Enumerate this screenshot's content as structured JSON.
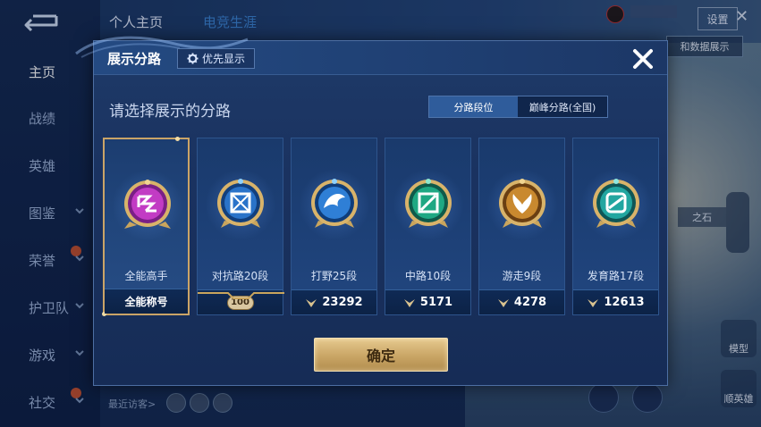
{
  "background": {
    "tabs": [
      "个人主页",
      "电竞生涯"
    ],
    "sidebar": [
      {
        "label": "主页",
        "active": true,
        "chevron": false,
        "badge": false
      },
      {
        "label": "战绩",
        "active": false,
        "chevron": false,
        "badge": false
      },
      {
        "label": "英雄",
        "active": false,
        "chevron": false,
        "badge": false
      },
      {
        "label": "图鉴",
        "active": false,
        "chevron": true,
        "badge": false
      },
      {
        "label": "荣誉",
        "active": false,
        "chevron": true,
        "badge": true
      },
      {
        "label": "护卫队",
        "active": false,
        "chevron": true,
        "badge": false
      },
      {
        "label": "游戏",
        "active": false,
        "chevron": true,
        "badge": false
      },
      {
        "label": "社交",
        "active": false,
        "chevron": true,
        "badge": true
      }
    ],
    "top_right_button": "设置",
    "data_display_chip": "和数据展示",
    "right_chip": "之石",
    "visitors_label": "最近访客>",
    "side_buttons": [
      "模型",
      "顺英雄"
    ]
  },
  "modal": {
    "title": "展示分路",
    "priority_button": "优先显示",
    "subtitle": "请选择展示的分路",
    "toggle": [
      {
        "label": "分路段位",
        "active": true
      },
      {
        "label": "巅峰分路(全国)",
        "active": false
      }
    ],
    "cards": [
      {
        "label": "全能高手",
        "bottom": "全能称号",
        "selected": true,
        "icon": "allround-emblem-icon",
        "color": "#c23bc4"
      },
      {
        "label": "对抗路20段",
        "bottom": "100",
        "selected": false,
        "icon": "clash-lane-emblem-icon",
        "color": "#2a73c9"
      },
      {
        "label": "打野25段",
        "bottom": "23292",
        "selected": false,
        "icon": "jungle-emblem-icon",
        "color": "#2f7fd6"
      },
      {
        "label": "中路10段",
        "bottom": "5171",
        "selected": false,
        "icon": "mid-lane-emblem-icon",
        "color": "#1fa883"
      },
      {
        "label": "游走9段",
        "bottom": "4278",
        "selected": false,
        "icon": "roam-emblem-icon",
        "color": "#c9892f"
      },
      {
        "label": "发育路17段",
        "bottom": "12613",
        "selected": false,
        "icon": "farm-lane-emblem-icon",
        "color": "#22a6a0"
      }
    ],
    "confirm_button": "确定"
  }
}
